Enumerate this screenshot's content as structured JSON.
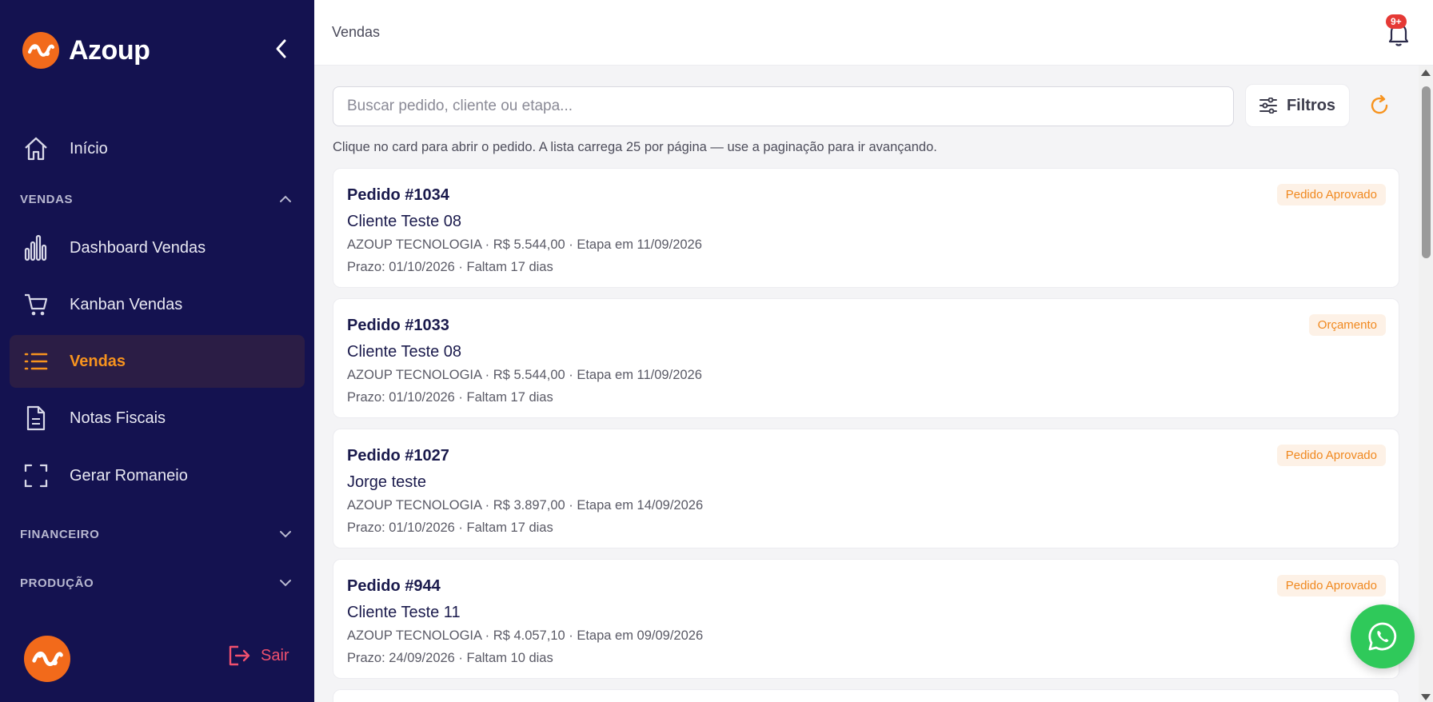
{
  "colors": {
    "sidebar_bg": "#141250",
    "accent": "#f7931e",
    "brand": "#f26a1b",
    "logout": "#f0506e",
    "badge_bg": "#fdf1e6",
    "whatsapp": "#2fc95a"
  },
  "brand": {
    "name": "Azoup"
  },
  "sidebar": {
    "home": {
      "label": "Início",
      "icon": "home-icon"
    },
    "sections": {
      "vendas": "VENDAS",
      "financeiro": "FINANCEIRO",
      "producao": "PRODUÇÃO"
    },
    "items": [
      {
        "label": "Dashboard Vendas",
        "icon": "bar-chart-icon"
      },
      {
        "label": "Kanban Vendas",
        "icon": "cart-icon"
      },
      {
        "label": "Vendas",
        "icon": "list-icon",
        "active": true
      },
      {
        "label": "Notas Fiscais",
        "icon": "document-icon"
      },
      {
        "label": "Gerar Romaneio",
        "icon": "scan-frame-icon"
      }
    ],
    "logout_label": "Sair"
  },
  "header": {
    "title": "Vendas",
    "notifications_badge": "9+"
  },
  "search": {
    "placeholder": "Buscar pedido, cliente ou etapa...",
    "value": ""
  },
  "filters_label": "Filtros",
  "hint": "Clique no card para abrir o pedido. A lista carrega 25 por página — use a paginação para ir avançando.",
  "orders": [
    {
      "title": "Pedido #1034",
      "client": "Cliente Teste 08",
      "meta": "AZOUP TECNOLOGIA · R$ 5.544,00 · Etapa em 11/09/2026",
      "due": "Prazo: 01/10/2026 · Faltam 17 dias",
      "status": "Pedido Aprovado"
    },
    {
      "title": "Pedido #1033",
      "client": "Cliente Teste 08",
      "meta": "AZOUP TECNOLOGIA · R$ 5.544,00 · Etapa em 11/09/2026",
      "due": "Prazo: 01/10/2026 · Faltam 17 dias",
      "status": "Orçamento"
    },
    {
      "title": "Pedido #1027",
      "client": "Jorge teste",
      "meta": "AZOUP TECNOLOGIA · R$ 3.897,00 · Etapa em 14/09/2026",
      "due": "Prazo: 01/10/2026 · Faltam 17 dias",
      "status": "Pedido Aprovado"
    },
    {
      "title": "Pedido #944",
      "client": "Cliente Teste 11",
      "meta": "AZOUP TECNOLOGIA · R$ 4.057,10 · Etapa em 09/09/2026",
      "due": "Prazo: 24/09/2026 · Faltam 10 dias",
      "status": "Pedido Aprovado"
    }
  ]
}
